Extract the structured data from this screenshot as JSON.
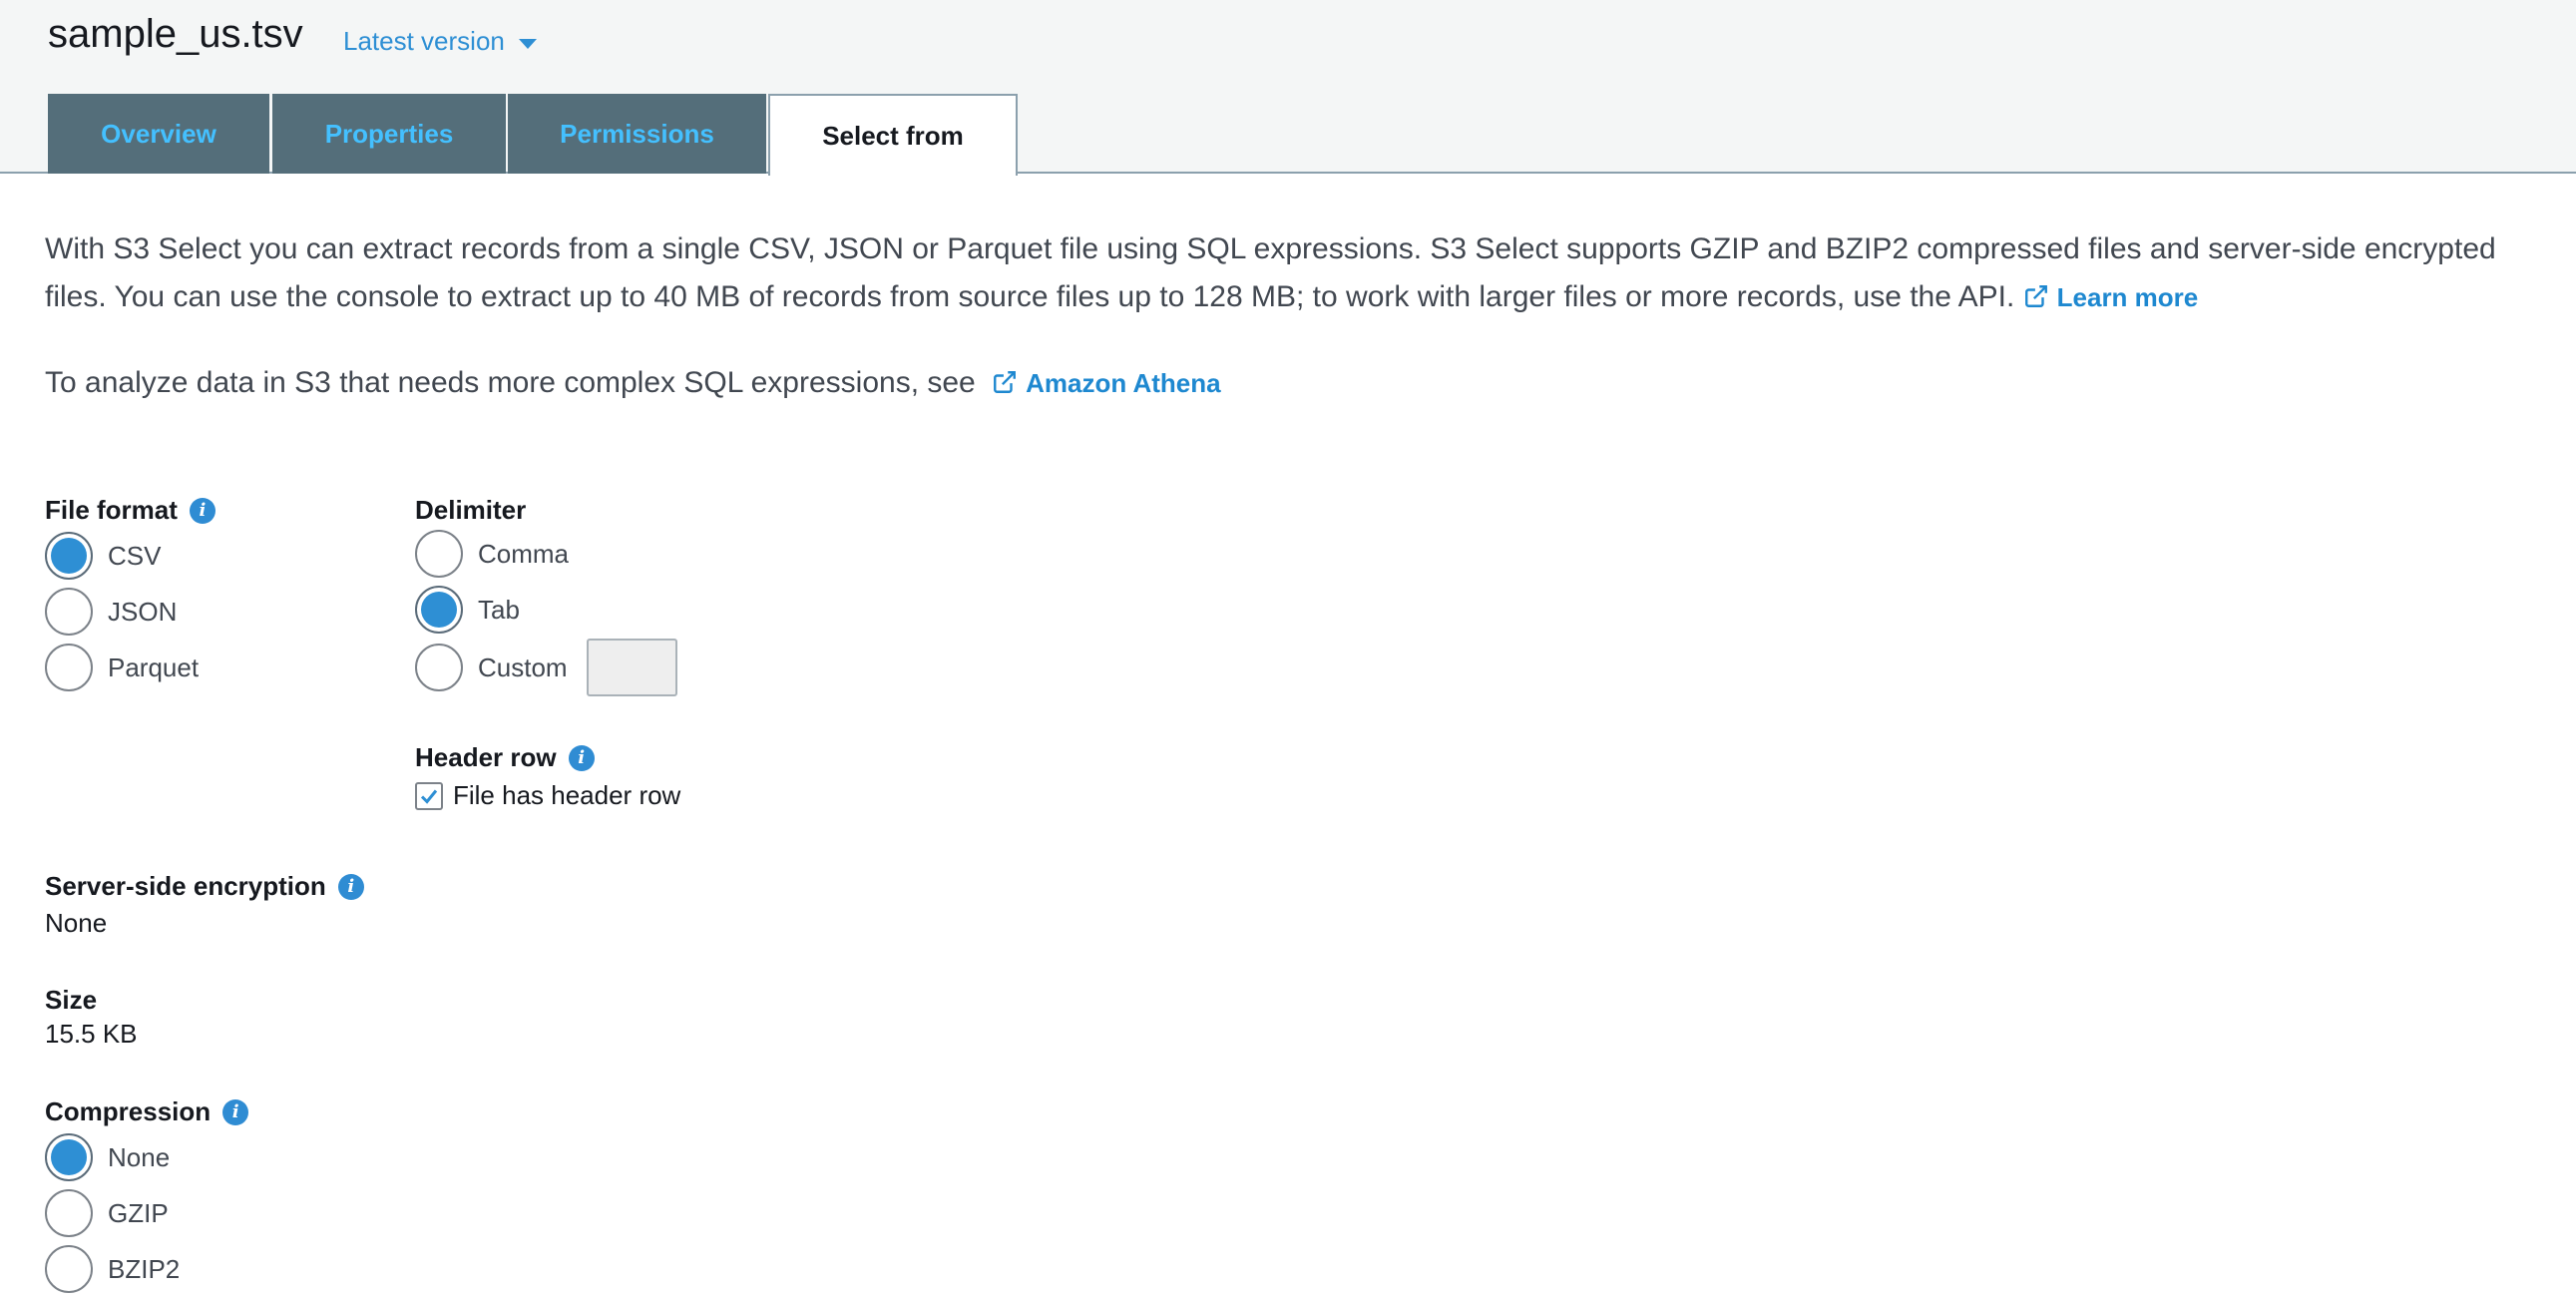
{
  "header": {
    "file_name": "sample_us.tsv",
    "version_label": "Latest version"
  },
  "tabs": [
    {
      "label": "Overview"
    },
    {
      "label": "Properties"
    },
    {
      "label": "Permissions"
    },
    {
      "label": "Select from",
      "active": true
    }
  ],
  "intro": {
    "text": "With S3 Select you can extract records from a single CSV, JSON or Parquet file using SQL expressions. S3 Select supports GZIP and BZIP2 compressed files and server-side encrypted files. You can use the console to extract up to 40 MB of records from source files up to 128 MB; to work with larger files or more records, use the API.",
    "learn_more": "Learn more",
    "athena_text": "To analyze data in S3 that needs more complex SQL expressions, see",
    "athena_link": "Amazon Athena"
  },
  "file_format": {
    "label": "File format",
    "options": [
      "CSV",
      "JSON",
      "Parquet"
    ],
    "selected": "CSV"
  },
  "delimiter": {
    "label": "Delimiter",
    "options": [
      "Comma",
      "Tab",
      "Custom"
    ],
    "selected": "Tab",
    "custom_value": ""
  },
  "header_row": {
    "label": "Header row",
    "checkbox_label": "File has header row",
    "checked": true
  },
  "encryption": {
    "label": "Server-side encryption",
    "value": "None"
  },
  "size": {
    "label": "Size",
    "value": "15.5 KB"
  },
  "compression": {
    "label": "Compression",
    "options": [
      "None",
      "GZIP",
      "BZIP2"
    ],
    "selected": "None"
  },
  "colors": {
    "accent": "#2e8fd4",
    "tab_bg": "#546e7a",
    "tab_text": "#44c0ff",
    "link": "#1e88d0"
  },
  "icons": {
    "info": "info-icon",
    "external_link": "external-link-icon",
    "caret": "caret-down-icon",
    "check": "check-icon"
  }
}
